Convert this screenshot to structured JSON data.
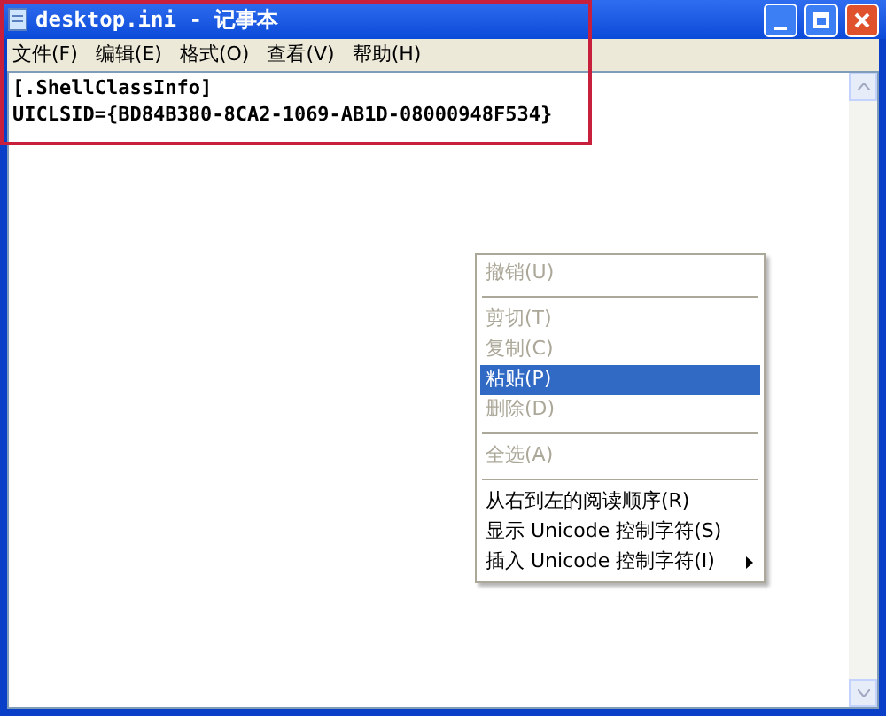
{
  "window": {
    "title": "desktop.ini - 记事本"
  },
  "menu_bar": [
    {
      "label": "文件(F)"
    },
    {
      "label": "编辑(E)"
    },
    {
      "label": "格式(O)"
    },
    {
      "label": "查看(V)"
    },
    {
      "label": "帮助(H)"
    }
  ],
  "editor": {
    "lines": [
      "[.ShellClassInfo]",
      "UICLSID={BD84B380-8CA2-1069-AB1D-08000948F534}"
    ]
  },
  "context_menu": [
    {
      "kind": "item",
      "label": "撤销(U)",
      "disabled": true,
      "selected": false
    },
    {
      "kind": "separator"
    },
    {
      "kind": "item",
      "label": "剪切(T)",
      "disabled": true,
      "selected": false
    },
    {
      "kind": "item",
      "label": "复制(C)",
      "disabled": true,
      "selected": false
    },
    {
      "kind": "item",
      "label": "粘贴(P)",
      "disabled": false,
      "selected": true
    },
    {
      "kind": "item",
      "label": "删除(D)",
      "disabled": true,
      "selected": false
    },
    {
      "kind": "separator"
    },
    {
      "kind": "item",
      "label": "全选(A)",
      "disabled": true,
      "selected": false
    },
    {
      "kind": "separator"
    },
    {
      "kind": "item",
      "label": "从右到左的阅读顺序(R)",
      "disabled": false,
      "selected": false
    },
    {
      "kind": "item",
      "label": "显示 Unicode 控制字符(S)",
      "disabled": false,
      "selected": false
    },
    {
      "kind": "item",
      "label": "插入 Unicode 控制字符(I)",
      "disabled": false,
      "selected": false,
      "submenu": true
    }
  ],
  "annotation": {
    "highlight": true
  }
}
